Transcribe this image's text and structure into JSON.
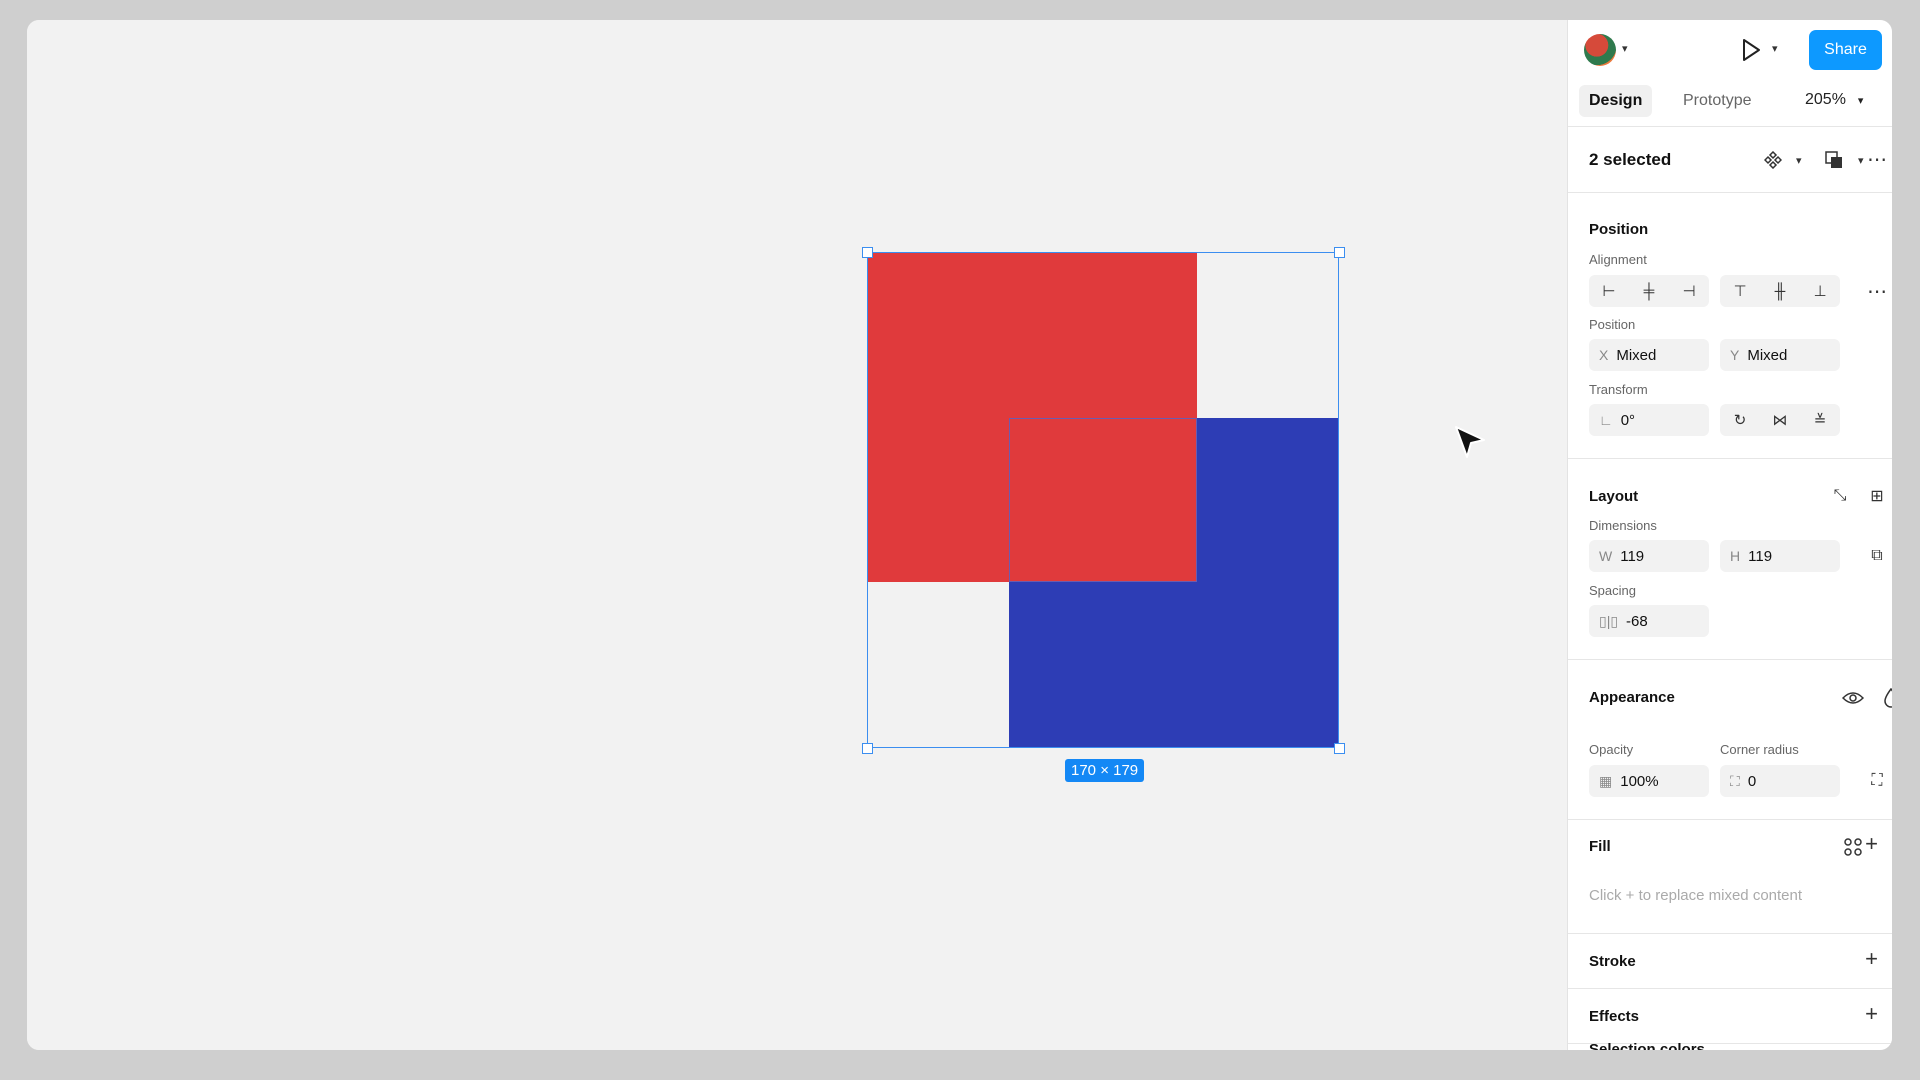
{
  "canvas": {
    "selection_size": "170 × 179",
    "colors": {
      "red": "#e03a3c",
      "blue": "#2d3db5",
      "selection": "#3b8ef0"
    }
  },
  "header": {
    "share_label": "Share",
    "tabs": [
      {
        "label": "Design"
      },
      {
        "label": "Prototype"
      }
    ],
    "zoom": "205%"
  },
  "selection": {
    "title": "2 selected"
  },
  "position": {
    "section_title": "Position",
    "alignment_label": "Alignment",
    "position_label": "Position",
    "x_prefix": "X",
    "x_value": "Mixed",
    "y_prefix": "Y",
    "y_value": "Mixed",
    "transform_label": "Transform",
    "rotation": "0°"
  },
  "layout": {
    "section_title": "Layout",
    "dimensions_label": "Dimensions",
    "w_prefix": "W",
    "w_value": "119",
    "h_prefix": "H",
    "h_value": "119",
    "spacing_label": "Spacing",
    "spacing_value": "-68"
  },
  "appearance": {
    "section_title": "Appearance",
    "opacity_label": "Opacity",
    "opacity_value": "100%",
    "corner_label": "Corner radius",
    "corner_value": "0"
  },
  "fill": {
    "section_title": "Fill",
    "hint": "Click + to replace mixed content"
  },
  "stroke": {
    "section_title": "Stroke"
  },
  "effects": {
    "section_title": "Effects"
  },
  "selection_colors": {
    "section_title": "Selection colors"
  }
}
